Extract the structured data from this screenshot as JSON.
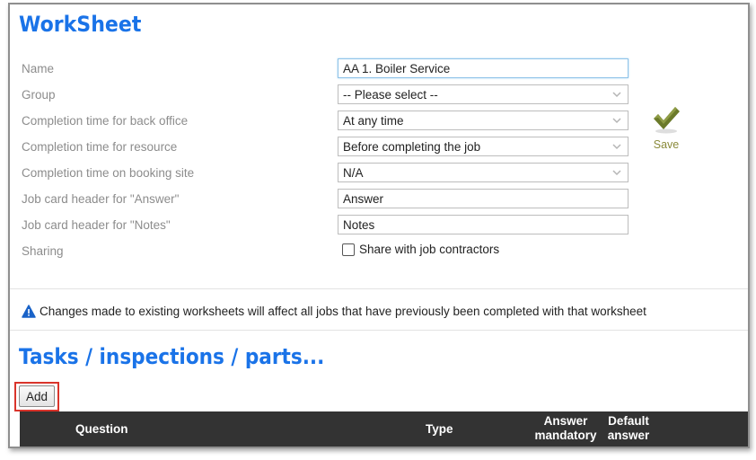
{
  "title": "WorkSheet",
  "form": {
    "rows": [
      {
        "label": "Name",
        "value": "AA 1. Boiler Service"
      },
      {
        "label": "Group",
        "value": "-- Please select --"
      },
      {
        "label": "Completion time for back office",
        "value": "At any time"
      },
      {
        "label": "Completion time for resource",
        "value": "Before completing the job"
      },
      {
        "label": "Completion time on booking site",
        "value": "N/A"
      },
      {
        "label": "Job card header for \"Answer\"",
        "value": "Answer"
      },
      {
        "label": "Job card header for \"Notes\"",
        "value": "Notes"
      },
      {
        "label": "Sharing",
        "value": ""
      }
    ],
    "share_label": "Share with job contractors",
    "share_checked": false
  },
  "save": {
    "label": "Save",
    "icon": "checkmark-icon"
  },
  "warning": {
    "icon": "warning-triangle-icon",
    "text": "Changes made to existing worksheets will affect all jobs that have previously been completed with that worksheet"
  },
  "tasks": {
    "title": "Tasks / inspections / parts...",
    "add_label": "Add",
    "columns": {
      "question": "Question",
      "type": "Type",
      "mandatory_1": "Answer",
      "mandatory_2": "mandatory",
      "default_1": "Default",
      "default_2": "answer"
    }
  },
  "colors": {
    "accent": "#1a73e8",
    "header_bg": "#333333",
    "highlight": "#d9342b",
    "save_green": "#6b7a2a"
  }
}
